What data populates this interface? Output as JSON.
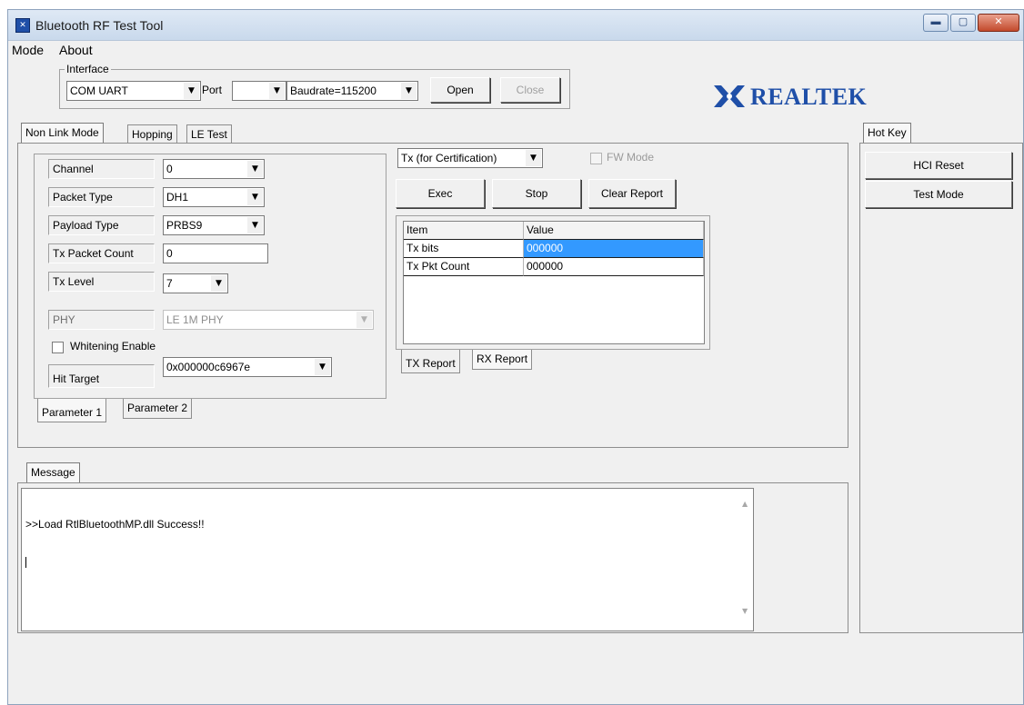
{
  "window": {
    "title": "Bluetooth RF Test Tool"
  },
  "menu": [
    "Mode",
    "About"
  ],
  "interface": {
    "legend": "Interface",
    "type_value": "COM UART",
    "port_label": "Port",
    "port_value": "",
    "baudrate_value": "Baudrate=115200",
    "open_label": "Open",
    "close_label": "Close"
  },
  "logo": {
    "text": "REALTEK",
    "color": "#1f4fa8"
  },
  "main_tabs": [
    "Non Link Mode",
    "Hopping",
    "LE Test"
  ],
  "params": {
    "channel_label": "Channel",
    "channel_value": "0",
    "packet_type_label": "Packet Type",
    "packet_type_value": "DH1",
    "payload_type_label": "Payload Type",
    "payload_type_value": "PRBS9",
    "tx_packet_count_label": "Tx Packet Count",
    "tx_packet_count_value": "0",
    "tx_level_label": "Tx Level",
    "tx_level_value": "7",
    "phy_label": "PHY",
    "phy_value": "LE 1M PHY",
    "whitening_label": "Whitening Enable",
    "hit_target_label": "Hit Target",
    "hit_target_value": "0x000000c6967e"
  },
  "param_tabs": [
    "Parameter 1",
    "Parameter 2"
  ],
  "test": {
    "mode_value": "Tx (for Certification)",
    "fw_mode_label": "FW Mode",
    "exec_label": "Exec",
    "stop_label": "Stop",
    "clear_label": "Clear Report"
  },
  "report": {
    "headers": [
      "Item",
      "Value"
    ],
    "rows": [
      {
        "item": "Tx bits",
        "value": "000000"
      },
      {
        "item": "Tx Pkt Count",
        "value": "000000"
      }
    ]
  },
  "report_tabs": [
    "TX Report",
    "RX Report"
  ],
  "message": {
    "tab": "Message",
    "text": ">>Load RtlBluetoothMP.dll Success!!"
  },
  "hotkey": {
    "tab": "Hot Key",
    "buttons": [
      "HCI Reset",
      "Test Mode"
    ]
  },
  "colors": {
    "selection": "#3399ff",
    "titlebar": "#c9d9ec"
  }
}
